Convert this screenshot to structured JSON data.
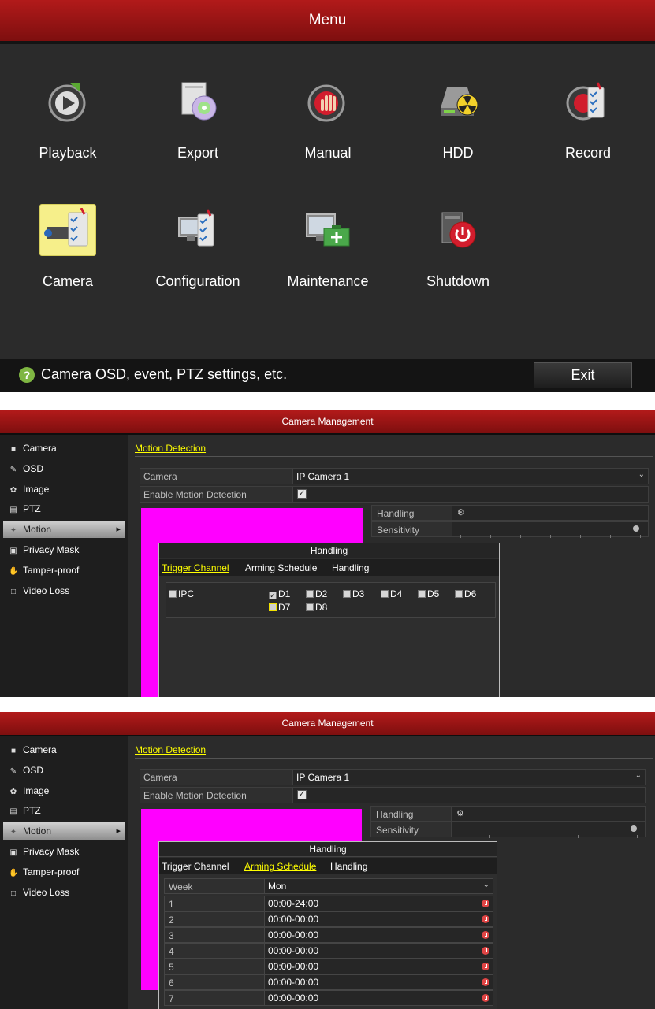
{
  "main_menu": {
    "title": "Menu",
    "items": [
      {
        "label": "Playback",
        "icon": "playback-icon"
      },
      {
        "label": "Export",
        "icon": "export-disc-icon"
      },
      {
        "label": "Manual",
        "icon": "manual-record-icon"
      },
      {
        "label": "HDD",
        "icon": "hdd-icon"
      },
      {
        "label": "Record",
        "icon": "record-settings-icon"
      },
      {
        "label": "Camera",
        "icon": "camera-icon",
        "selected": true
      },
      {
        "label": "Configuration",
        "icon": "configuration-icon"
      },
      {
        "label": "Maintenance",
        "icon": "maintenance-icon"
      },
      {
        "label": "Shutdown",
        "icon": "shutdown-icon"
      }
    ],
    "hint": "Camera OSD, event, PTZ settings, etc.",
    "exit_label": "Exit"
  },
  "camera_management": {
    "title": "Camera Management",
    "sidebar": [
      {
        "label": "Camera",
        "icon": "camera-icon"
      },
      {
        "label": "OSD",
        "icon": "osd-icon"
      },
      {
        "label": "Image",
        "icon": "image-icon"
      },
      {
        "label": "PTZ",
        "icon": "ptz-icon"
      },
      {
        "label": "Motion",
        "icon": "motion-icon",
        "active": true
      },
      {
        "label": "Privacy Mask",
        "icon": "privacy-mask-icon"
      },
      {
        "label": "Tamper-proof",
        "icon": "tamper-proof-icon"
      },
      {
        "label": "Video Loss",
        "icon": "video-loss-icon"
      }
    ],
    "section_tab": "Motion Detection",
    "camera_label": "Camera",
    "camera_value": "IP Camera 1",
    "enable_label": "Enable Motion Detection",
    "enable_checked": true,
    "handling_label": "Handling",
    "sensitivity_label": "Sensitivity",
    "sensitivity_level": 0.98
  },
  "handling_dialog": {
    "title": "Handling",
    "tabs": [
      "Trigger Channel",
      "Arming Schedule",
      "Handling"
    ],
    "trigger_channel": {
      "ipc_label": "IPC",
      "channels": [
        {
          "label": "D1",
          "checked": true
        },
        {
          "label": "D2",
          "checked": false
        },
        {
          "label": "D3",
          "checked": false
        },
        {
          "label": "D4",
          "checked": false
        },
        {
          "label": "D5",
          "checked": false
        },
        {
          "label": "D6",
          "checked": false
        },
        {
          "label": "D7",
          "checked": false,
          "focused": true
        },
        {
          "label": "D8",
          "checked": false
        }
      ]
    },
    "arming_schedule": {
      "week_label": "Week",
      "week_value": "Mon",
      "periods": [
        {
          "index": "1",
          "time": "00:00-24:00"
        },
        {
          "index": "2",
          "time": "00:00-00:00"
        },
        {
          "index": "3",
          "time": "00:00-00:00"
        },
        {
          "index": "4",
          "time": "00:00-00:00"
        },
        {
          "index": "5",
          "time": "00:00-00:00"
        },
        {
          "index": "6",
          "time": "00:00-00:00"
        },
        {
          "index": "7",
          "time": "00:00-00:00"
        }
      ]
    }
  },
  "colors": {
    "title_red": "#9a1414",
    "panel_bg": "#2b2b2b",
    "active_tab": "#ffff00",
    "motion_area": "#ff00ff",
    "selected_tile": "#f6ef8a"
  }
}
